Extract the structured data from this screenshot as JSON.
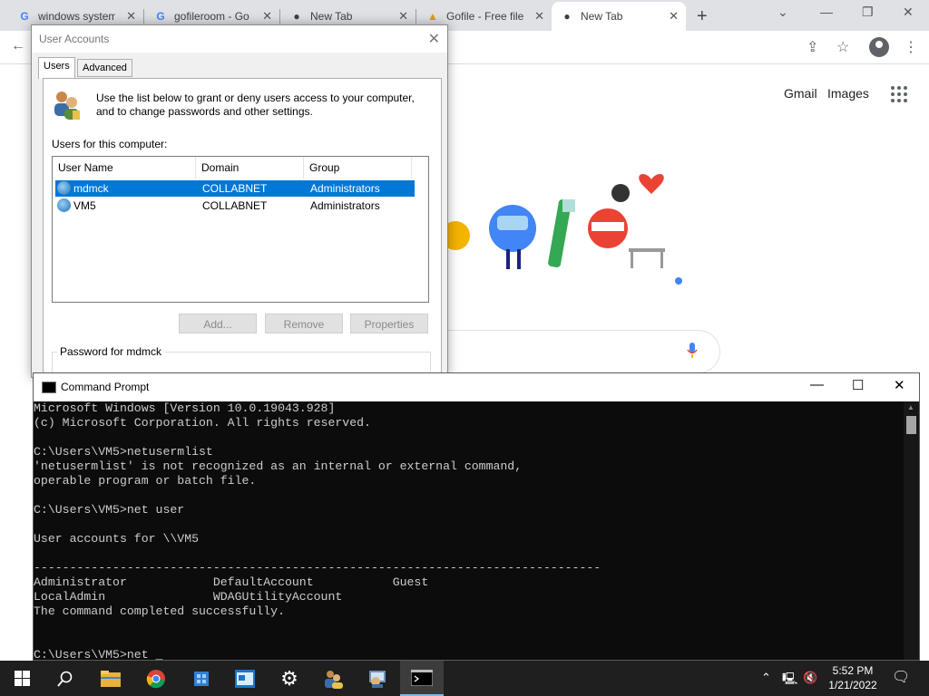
{
  "browser": {
    "tabs": [
      {
        "title": "windows system",
        "favicon": "google-g-icon"
      },
      {
        "title": "gofileroom - Go",
        "favicon": "google-g-icon"
      },
      {
        "title": "New Tab",
        "favicon": "chrome-icon"
      },
      {
        "title": "Gofile - Free file",
        "favicon": "gofile-icon"
      },
      {
        "title": "New Tab",
        "favicon": "chrome-icon"
      }
    ],
    "links": {
      "gmail": "Gmail",
      "images": "Images"
    }
  },
  "accounts": {
    "title": "User Accounts",
    "tabs": {
      "users": "Users",
      "advanced": "Advanced"
    },
    "intro": "Use the list below to grant or deny users access to your computer, and to change passwords and other settings.",
    "users_label": "Users for this computer:",
    "columns": [
      "User Name",
      "Domain",
      "Group"
    ],
    "rows": [
      {
        "name": "mdmck",
        "domain": "COLLABNET",
        "group": "Administrators"
      },
      {
        "name": "VM5",
        "domain": "COLLABNET",
        "group": "Administrators"
      }
    ],
    "buttons": {
      "add": "Add...",
      "remove": "Remove",
      "properties": "Properties"
    },
    "password_label": "Password for mdmck"
  },
  "cmd": {
    "title": "Command Prompt",
    "lines": [
      "Microsoft Windows [Version 10.0.19043.928]",
      "(c) Microsoft Corporation. All rights reserved.",
      "",
      "C:\\Users\\VM5>netusermlist",
      "'netusermlist' is not recognized as an internal or external command,",
      "operable program or batch file.",
      "",
      "C:\\Users\\VM5>net user",
      "",
      "User accounts for \\\\VM5",
      "",
      "-------------------------------------------------------------------------------",
      "Administrator            DefaultAccount           Guest",
      "LocalAdmin               WDAGUtilityAccount",
      "The command completed successfully.",
      "",
      "",
      "C:\\Users\\VM5>net _"
    ]
  },
  "taskbar": {
    "time": "5:52 PM",
    "date": "1/21/2022",
    "icons": [
      "start-icon",
      "search-icon",
      "file-explorer-icon",
      "chrome-icon",
      "network-icon",
      "control-panel-icon",
      "settings-icon",
      "user-accounts-icon",
      "computer-management-icon",
      "command-prompt-icon"
    ]
  },
  "colors": {
    "selection": "#0078d7",
    "console_bg": "#0c0c0c",
    "taskbar_bg": "#1f1f1f"
  }
}
